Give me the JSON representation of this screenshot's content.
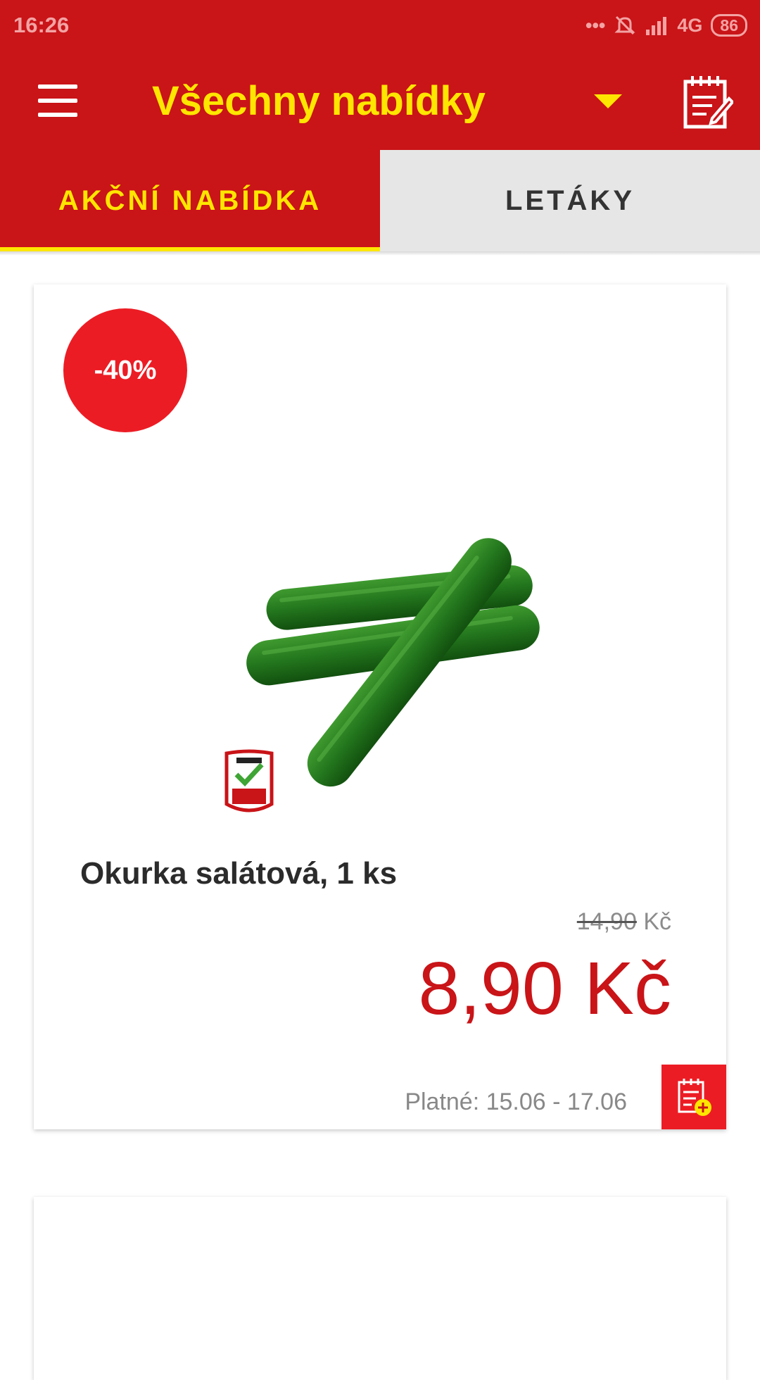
{
  "status_bar": {
    "time": "16:26",
    "network": "4G",
    "battery": "86",
    "icons": [
      "more-dots-icon",
      "bell-off-icon",
      "signal-icon",
      "battery-icon"
    ]
  },
  "header": {
    "title": "Všechny nabídky",
    "icons": [
      "menu-icon",
      "dropdown-caret-icon",
      "shopping-list-icon"
    ]
  },
  "tabs": [
    {
      "label": "AKČNÍ NABÍDKA",
      "active": true
    },
    {
      "label": "LETÁKY",
      "active": false
    }
  ],
  "offers": [
    {
      "discount": "-40%",
      "product_name": "Okurka salátová, 1 ks",
      "old_price_value": "14,90",
      "old_price_currency": "Kč",
      "new_price": "8,90 Kč",
      "validity": "Platné: 15.06 - 17.06",
      "badge_icon": "fer-potravina-badge-icon",
      "add_icon": "add-to-list-icon"
    }
  ],
  "colors": {
    "brand_red": "#c91418",
    "accent_yellow": "#ffe600",
    "badge_red": "#ec1c24",
    "price_red": "#c91418"
  }
}
